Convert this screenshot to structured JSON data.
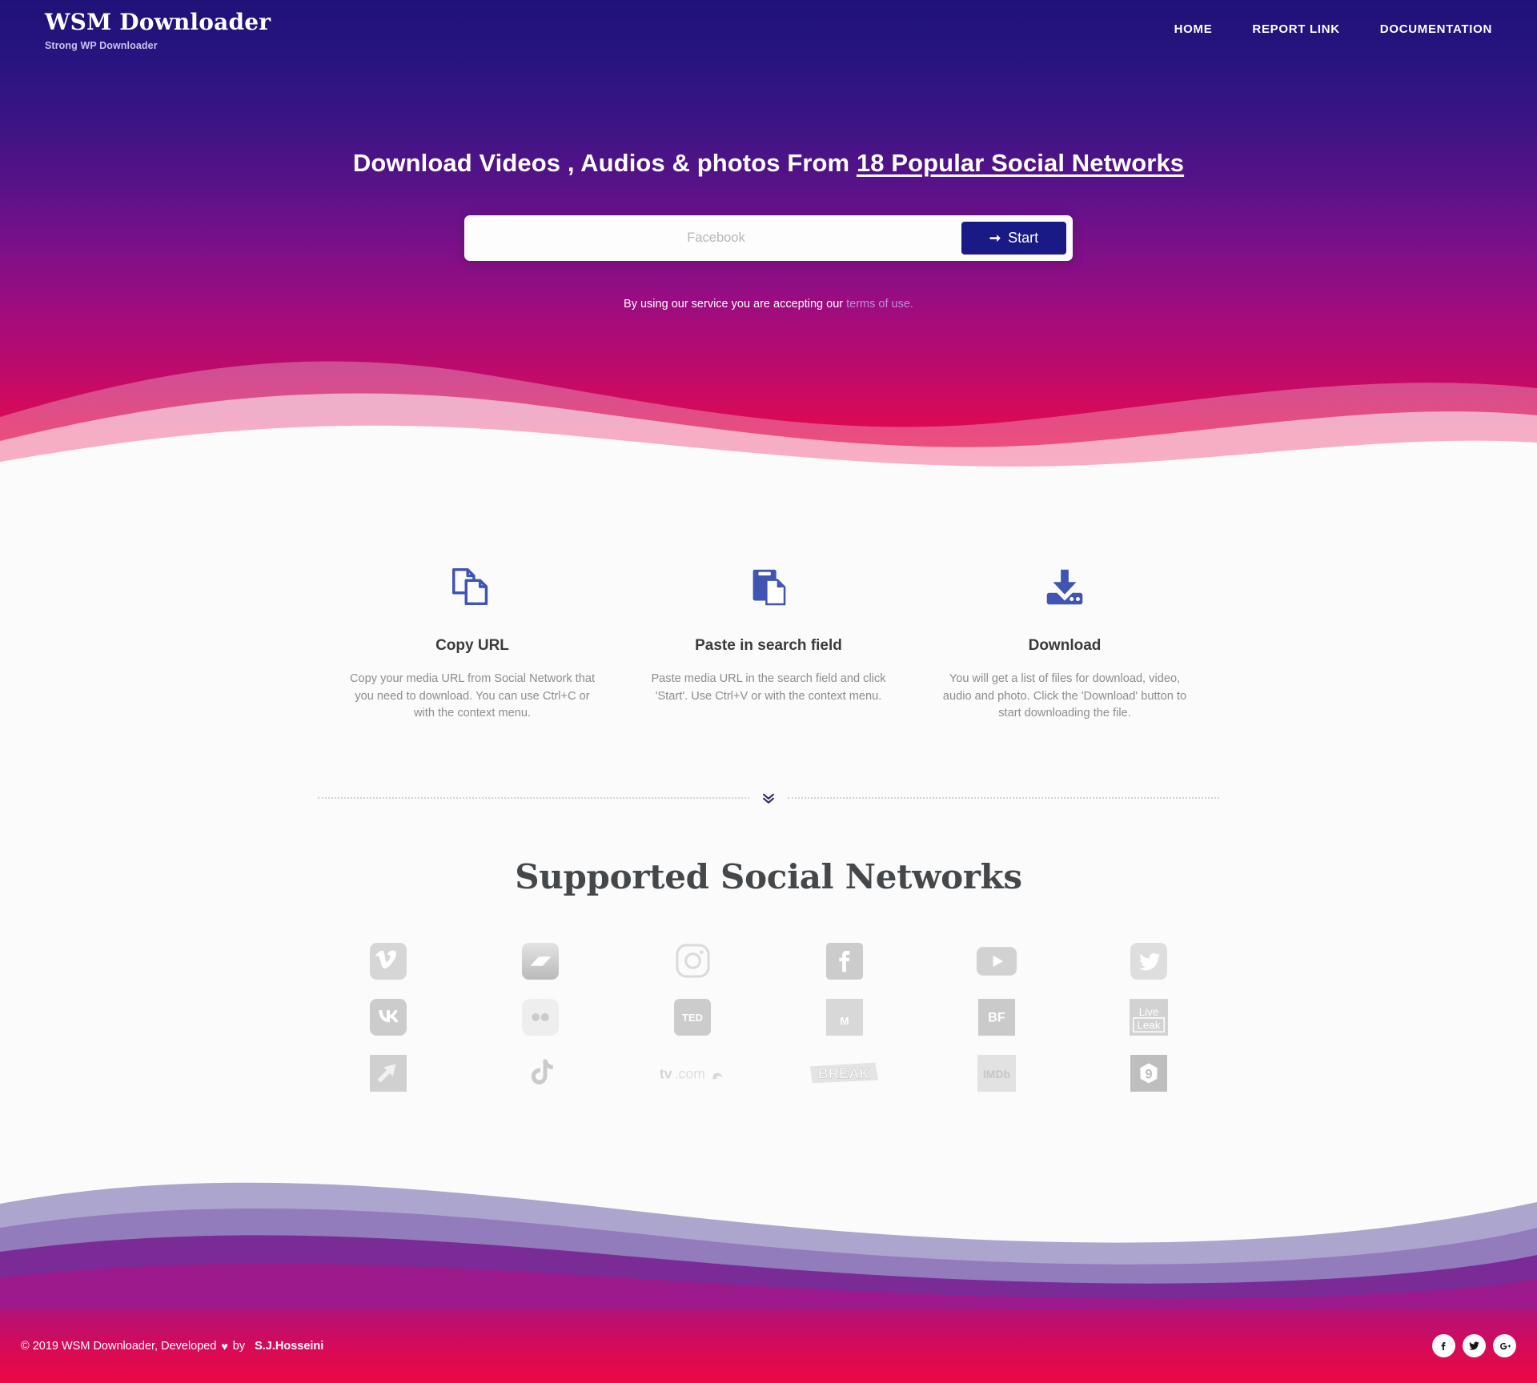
{
  "header": {
    "brand_title": "WSM Downloader",
    "brand_subtitle": "Strong WP Downloader",
    "nav": [
      {
        "label": "HOME",
        "name": "nav-link-home"
      },
      {
        "label": "REPORT LINK",
        "name": "nav-link-report"
      },
      {
        "label": "DOCUMENTATION",
        "name": "nav-link-documentation"
      }
    ]
  },
  "hero": {
    "title_prefix": "Download Videos , Audios & photos From ",
    "title_highlight": "18 Popular Social Networks",
    "search_placeholder": "Facebook",
    "search_value": "",
    "start_label": "Start",
    "start_icon": "arrow-right-icon",
    "terms_prefix": "By using our service you are accepting our ",
    "terms_link": "terms of use.",
    "gradient_top": "#1e1278",
    "gradient_bottom": "#f00842"
  },
  "features": [
    {
      "icon": "copy-documents-icon",
      "title": "Copy URL",
      "text": "Copy your media URL from Social Network that you need to download. You can use Ctrl+C or with the context menu."
    },
    {
      "icon": "paste-clipboard-icon",
      "title": "Paste in search field",
      "text": "Paste media URL in the search field and click 'Start'. Use Ctrl+V or with the context menu."
    },
    {
      "icon": "download-tray-icon",
      "title": "Download",
      "text": "You will get a list of files for download, video, audio and photo. Click the 'Download' button to start downloading the file."
    }
  ],
  "divider": {
    "icon": "double-chevron-down-icon"
  },
  "networks": {
    "heading": "Supported Social Networks",
    "items": [
      {
        "name": "vimeo",
        "label": "Vimeo"
      },
      {
        "name": "dailymotion",
        "label": "Dailymotion"
      },
      {
        "name": "instagram",
        "label": "Instagram"
      },
      {
        "name": "facebook",
        "label": "Facebook"
      },
      {
        "name": "youtube",
        "label": "YouTube"
      },
      {
        "name": "twitter",
        "label": "Twitter"
      },
      {
        "name": "vk",
        "label": "VK"
      },
      {
        "name": "flickr",
        "label": "Flickr"
      },
      {
        "name": "ted",
        "label": "TED"
      },
      {
        "name": "metacafe",
        "label": "M"
      },
      {
        "name": "buzzfeed",
        "label": "BF"
      },
      {
        "name": "liveleak",
        "label": "LiveLeak"
      },
      {
        "name": "veoh",
        "label": "Veoh"
      },
      {
        "name": "tiktok",
        "label": "TikTok"
      },
      {
        "name": "tvcom",
        "label": "tv.com"
      },
      {
        "name": "break",
        "label": "BREAK"
      },
      {
        "name": "imdb",
        "label": "IMDb"
      },
      {
        "name": "9gag",
        "label": "9GAG"
      }
    ]
  },
  "footer": {
    "copyright_prefix": "© 2019 WSM Downloader, Developed ",
    "heart": "♥",
    "by": " by",
    "author": "S.J.Hosseini",
    "social": [
      {
        "name": "facebook-icon",
        "label": "Facebook"
      },
      {
        "name": "twitter-icon",
        "label": "Twitter"
      },
      {
        "name": "google-plus-icon",
        "label": "Google Plus"
      }
    ]
  }
}
